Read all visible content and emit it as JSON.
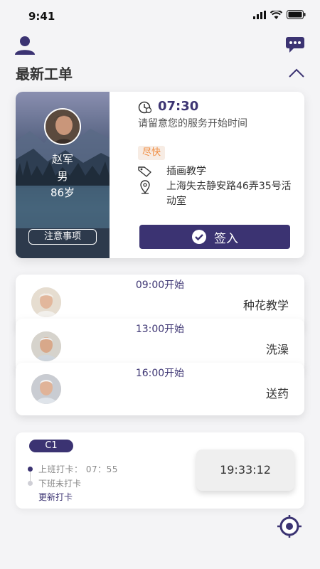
{
  "status_bar": {
    "time": "9:41"
  },
  "header": {
    "title": "最新工单"
  },
  "current_order": {
    "person": {
      "name": "赵军",
      "gender": "男",
      "age": "86岁"
    },
    "notes_label": "注意事项",
    "time": "07:30",
    "hint": "请留意您的服务开始时间",
    "badge": "尽快",
    "service": "插画教学",
    "address": "上海失去静安路46弄35号活动室",
    "signin_label": "签入"
  },
  "tasks": [
    {
      "start": "09:00开始",
      "name": "种花教学"
    },
    {
      "start": "13:00开始",
      "name": "洗澡"
    },
    {
      "start": "16:00开始",
      "name": "送药"
    }
  ],
  "attendance": {
    "shift": "C1",
    "checkin": "上班打卡：  07：55",
    "checkout": "下班未打卡",
    "update_label": "更新打卡",
    "clock": "19:33:12"
  },
  "colors": {
    "accent": "#3b3372",
    "urgent": "#f08a3c"
  },
  "icons": [
    "user-icon",
    "chat-icon",
    "chevron-up-icon",
    "clock-icon",
    "tag-icon",
    "location-pin-icon",
    "check-icon",
    "locate-icon"
  ]
}
